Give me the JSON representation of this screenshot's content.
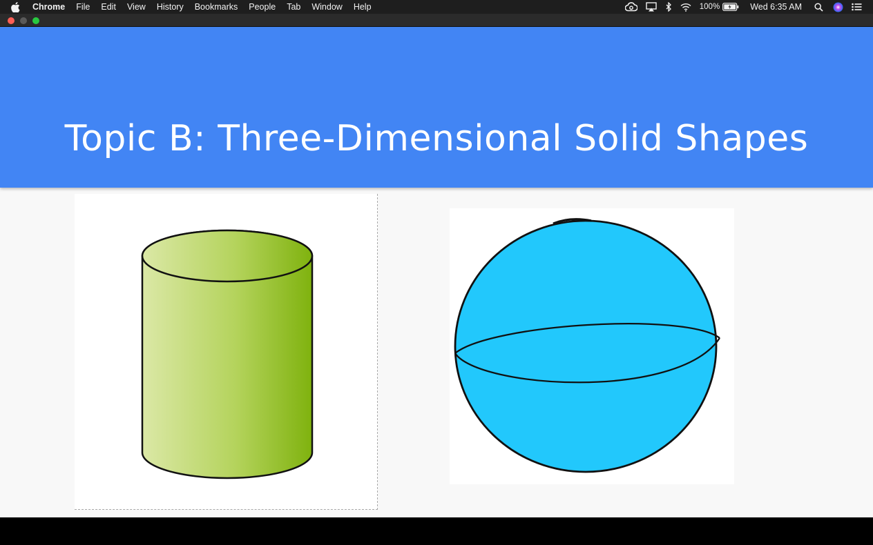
{
  "menubar": {
    "app_name": "Chrome",
    "items": [
      "File",
      "Edit",
      "View",
      "History",
      "Bookmarks",
      "People",
      "Tab",
      "Window",
      "Help"
    ],
    "battery_percent": "100%",
    "clock": "Wed 6:35 AM",
    "icons": [
      "apple-icon",
      "creative-cloud-icon",
      "airplay-icon",
      "bluetooth-icon",
      "wifi-icon",
      "battery-icon",
      "spotlight-search-icon",
      "siri-icon",
      "notification-center-icon"
    ]
  },
  "window": {
    "traffic_lights": [
      "close",
      "minimize",
      "fullscreen"
    ]
  },
  "slide": {
    "title": "Topic B: Three-Dimensional Solid Shapes",
    "header_color": "#4285f4",
    "images": [
      {
        "name": "cylinder-image",
        "fill_colors": [
          "#dbe8a6",
          "#7fb20e"
        ]
      },
      {
        "name": "sphere-image",
        "fill_color": "#22c8fc"
      }
    ]
  }
}
